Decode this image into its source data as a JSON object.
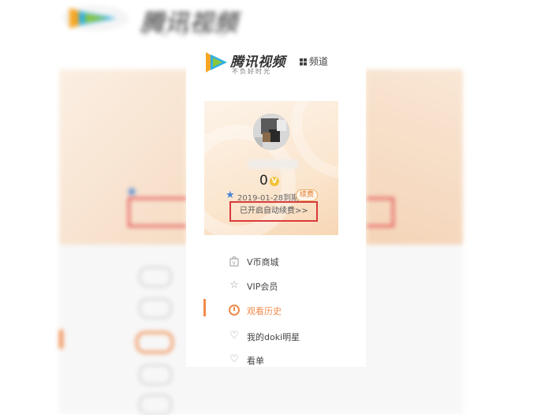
{
  "header": {
    "brand_name": "腾讯视频",
    "slogan": "不负好时光",
    "channel_label": "频道"
  },
  "vip_card": {
    "coins": "0",
    "coin_badge": "V",
    "expiry": "2019-01-28到期",
    "renew_label": "续费",
    "auto_renew_text": "已开启自动续费>>"
  },
  "menu": {
    "items": [
      {
        "label": "V币商城",
        "icon": "shopping-bag-icon"
      },
      {
        "label": "VIP会员",
        "icon": "crown-icon"
      },
      {
        "label": "观看历史",
        "icon": "clock-icon"
      },
      {
        "label": "我的doki明星",
        "icon": "heart-icon"
      },
      {
        "label": "看单",
        "icon": "heart-plus-icon"
      }
    ],
    "active_index": 2
  },
  "colors": {
    "accent": "#f08a4b",
    "highlight_box": "#d93a3a",
    "star": "#4a86d6",
    "coin": "#f2c23a"
  }
}
